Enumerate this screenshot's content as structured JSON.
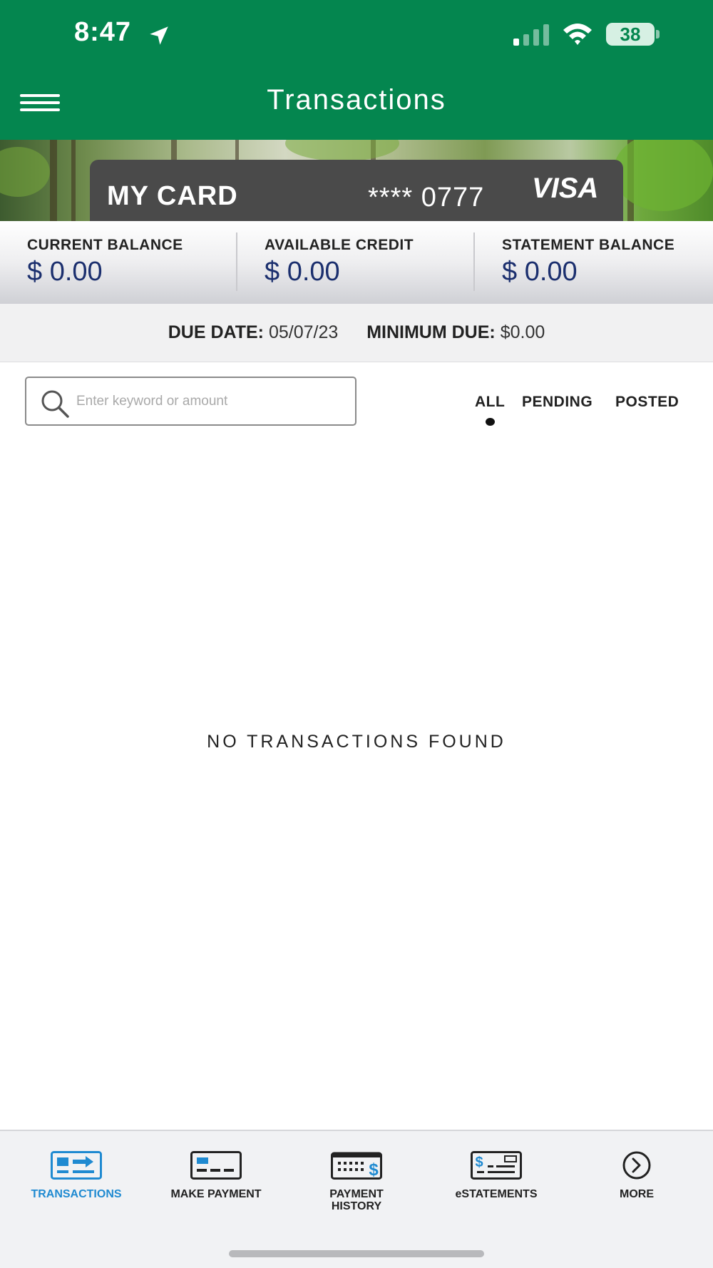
{
  "status_bar": {
    "time": "8:47",
    "battery": "38"
  },
  "header": {
    "title": "Transactions"
  },
  "card": {
    "name": "MY CARD",
    "number": "**** 0777",
    "brand": "VISA"
  },
  "balances": [
    {
      "label": "CURRENT BALANCE",
      "value": "$ 0.00"
    },
    {
      "label": "AVAILABLE CREDIT",
      "value": "$ 0.00"
    },
    {
      "label": "STATEMENT BALANCE",
      "value": "$ 0.00"
    }
  ],
  "due": {
    "date_label": "DUE DATE:",
    "date_value": "05/07/23",
    "min_label": "MINIMUM DUE:",
    "min_value": "$0.00"
  },
  "search": {
    "placeholder": "Enter keyword or amount",
    "value": ""
  },
  "filters": {
    "tabs": [
      "ALL",
      "PENDING",
      "POSTED"
    ],
    "active": "ALL"
  },
  "empty_message": "NO TRANSACTIONS FOUND",
  "tabbar": {
    "items": [
      {
        "label": "TRANSACTIONS",
        "icon": "transactions-icon"
      },
      {
        "label": "MAKE PAYMENT",
        "icon": "card-payment-icon"
      },
      {
        "label": "PAYMENT HISTORY",
        "icon": "calendar-dollar-icon"
      },
      {
        "label": "eSTATEMENTS",
        "icon": "check-statement-icon"
      },
      {
        "label": "MORE",
        "icon": "chevron-right-circle-icon"
      }
    ],
    "active": "TRANSACTIONS"
  },
  "colors": {
    "brand_green": "#04864f",
    "balance_blue": "#1b2f6e",
    "active_tab_blue": "#1f8ad1"
  }
}
